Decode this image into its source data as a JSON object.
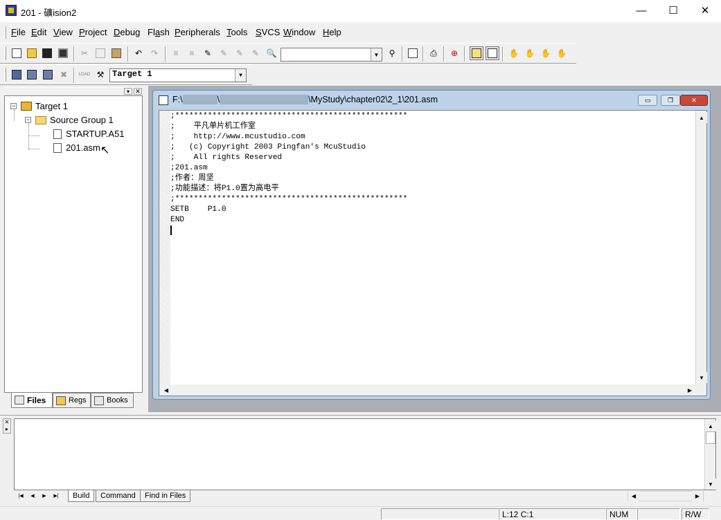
{
  "window": {
    "title": "201  - 礦ision2",
    "minimize": "—",
    "maximize": "☐",
    "close": "✕"
  },
  "menu": [
    {
      "label": "File",
      "u": "F",
      "rest": "ile"
    },
    {
      "label": "Edit",
      "u": "E",
      "rest": "dit"
    },
    {
      "label": "View",
      "u": "V",
      "rest": "iew"
    },
    {
      "label": "Project",
      "u": "P",
      "rest": "roject"
    },
    {
      "label": "Debug",
      "u": "D",
      "rest": "ebug"
    },
    {
      "label": "Flash",
      "u": "F",
      "rest": "lash",
      "pre": "Fl",
      "u2": "a",
      "rest2": "sh"
    },
    {
      "label": "Peripherals",
      "u": "P",
      "rest": "eripherals"
    },
    {
      "label": "Tools",
      "u": "T",
      "rest": "ools"
    },
    {
      "label": "SVCS",
      "u": "S",
      "rest": "VCS"
    },
    {
      "label": "Window",
      "u": "W",
      "rest": "indow"
    },
    {
      "label": "Help",
      "u": "H",
      "rest": "elp"
    }
  ],
  "toolbar": {
    "find_combo_value": "",
    "target_combo_value": "Target 1",
    "load_label": "LOAD"
  },
  "project": {
    "target": "Target 1",
    "group": "Source Group 1",
    "files": [
      "STARTUP.A51",
      "201.asm"
    ],
    "tabs": {
      "files": "Files",
      "regs": "Regs",
      "books": "Books"
    }
  },
  "editor": {
    "title_prefix": "F:\\",
    "title_mid": "\\",
    "title_suffix": "\\MyStudy\\chapter02\\2_1\\201.asm",
    "code": ";**************************************************\n;    平凡单片机工作室\n;    http://www.mcustudio.com\n;   (c) Copyright 2003 Pingfan's McuStudio\n;    All rights Reserved\n;201.asm\n;作者：周坚\n;功能描述：将P1.0置为高电平\n;**************************************************\nSETB    P1.0\nEND\n"
  },
  "output": {
    "tabs": [
      "Build",
      "Command",
      "Find in Files"
    ]
  },
  "status": {
    "position": "L:12 C:1",
    "num": "NUM",
    "rw": "R/W"
  },
  "colors": {
    "caption": "#bcd3ea",
    "mdi_bg": "#abaeb5",
    "close_btn": "#c8483a"
  }
}
